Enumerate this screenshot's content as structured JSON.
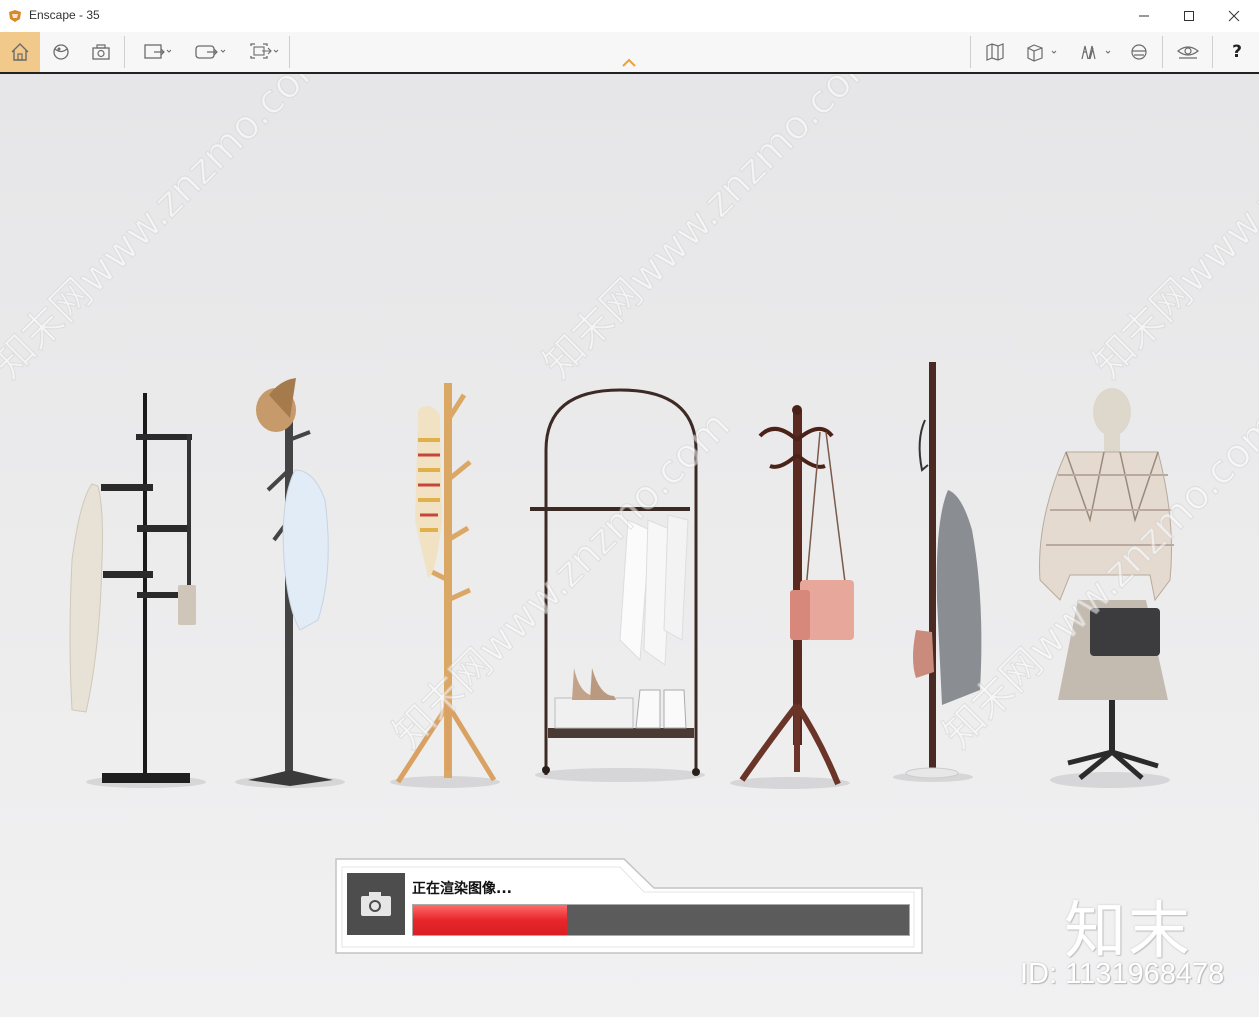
{
  "window": {
    "title": "Enscape - 35",
    "minimize_icon": "minimize-icon",
    "maximize_icon": "maximize-icon",
    "close_icon": "close-icon"
  },
  "toolbar": {
    "left_buttons": [
      "home-icon",
      "orbit-icon",
      "screenshot-icon",
      "view-export-icon",
      "video-export-icon",
      "panorama-export-icon"
    ],
    "right_buttons": [
      "map-icon",
      "cube-view-icon",
      "assets-icon",
      "headset-icon",
      "visual-settings-icon"
    ],
    "help_label": "?",
    "collapse_icon": "chevron-up-icon",
    "active_color": "#f1c98a",
    "accent_color": "#f0a030"
  },
  "render": {
    "status": "正在渲染图像...",
    "progress": 0.31,
    "progress_color": "#e8262b",
    "camera_icon": "camera-icon"
  },
  "watermark": {
    "logo_text": "知末",
    "id_text": "ID: 1131968478",
    "diagonal_text": "知末网www.znzmo.com"
  }
}
